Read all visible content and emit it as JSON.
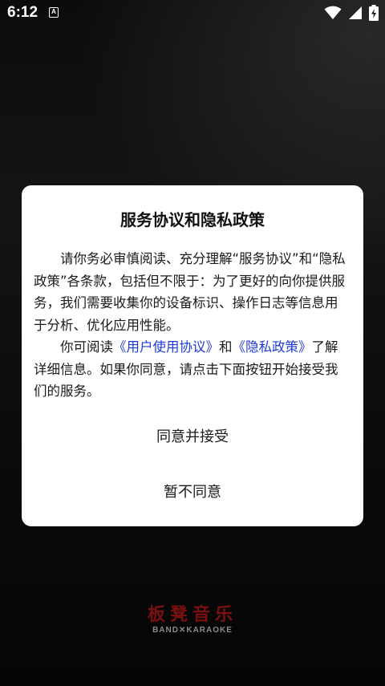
{
  "status_bar": {
    "time": "6:12",
    "notification_icon": "A",
    "icons": [
      "wifi-icon",
      "signal-icon",
      "battery-charging-icon"
    ]
  },
  "dialog": {
    "title": "服务协议和隐私政策",
    "para1": "请你务必审慎阅读、充分理解“服务协议”和“隐私政策”各条款，包括但不限于：为了更好的向你提供服务，我们需要收集你的设备标识、操作日志等信息用于分析、优化应用性能。",
    "para2_prefix": "你可阅读",
    "user_agreement_link": "《用户使用协议》",
    "para2_and": "和",
    "privacy_policy_link": "《隐私政策》",
    "para2_suffix": "了解详细信息。如果你同意，请点击下面按钮开始接受我们的服务。",
    "agree_label": "同意并接受",
    "decline_label": "暂不同意"
  },
  "brand": {
    "cn": "板凳音乐",
    "en": "BAND✕KARAOKE"
  },
  "colors": {
    "link": "#1f3bd6",
    "brand_red": "#7a1010"
  }
}
